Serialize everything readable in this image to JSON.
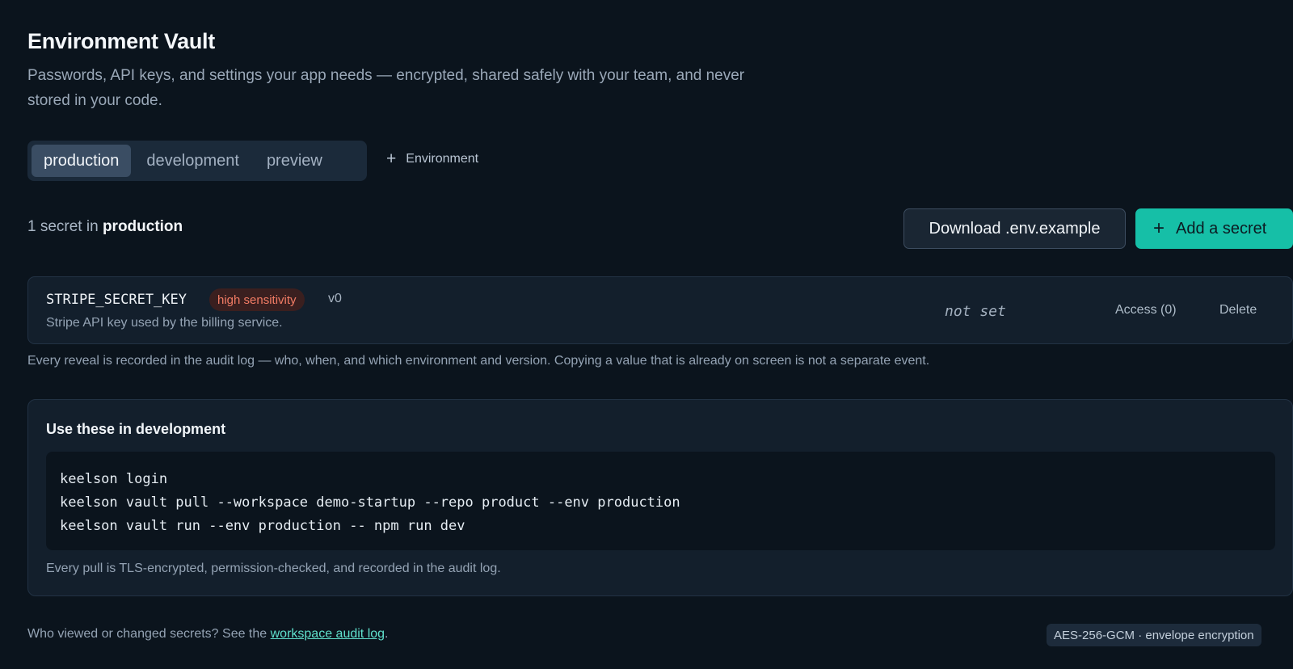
{
  "header": {
    "title": "Environment Vault",
    "subtitle": "Passwords, API keys, and settings your app needs — encrypted, shared safely with your team, and never stored in your code."
  },
  "tabs": [
    {
      "label": "production",
      "active": true
    },
    {
      "label": "development",
      "active": false
    },
    {
      "label": "preview",
      "active": false
    }
  ],
  "add_environment_label": "Environment",
  "summary": {
    "prefix": "1 secret in",
    "environment": "production"
  },
  "actions": {
    "download_label": "Download .env.example",
    "add_secret_label": "Add a secret"
  },
  "secret": {
    "name": "STRIPE_SECRET_KEY",
    "badge": "high sensitivity",
    "version": "v0",
    "description": "Stripe API key used by the billing service.",
    "value_status": "not set",
    "access_label": "Access (0)",
    "delete_label": "Delete"
  },
  "audit_note": "Every reveal is recorded in the audit log — who, when, and which environment and version. Copying a value that is already on screen is not a separate event.",
  "dev_panel": {
    "title": "Use these in development",
    "code_lines": [
      "keelson login",
      "keelson vault pull --workspace demo-startup --repo product --env production",
      "keelson vault run --env production -- npm run dev"
    ],
    "note": "Every pull is TLS-encrypted, permission-checked, and recorded in the audit log."
  },
  "footer": {
    "prefix": "Who viewed or changed secrets? See the",
    "link": "workspace audit log",
    "suffix": ".",
    "encryption_badge": "AES-256-GCM · envelope encryption"
  },
  "colors": {
    "background": "#0b141d",
    "accent": "#16bfa7",
    "danger": "#f27c65",
    "link": "#5fe0cc"
  },
  "icons": {
    "add": "plus-icon"
  }
}
